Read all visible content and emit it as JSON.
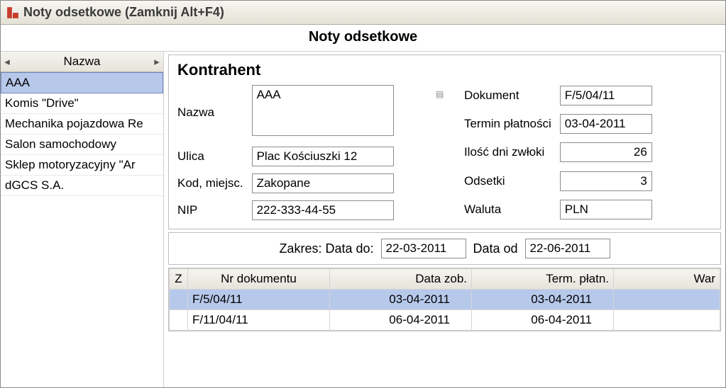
{
  "window": {
    "title": "Noty odsetkowe (Zamknij Alt+F4)"
  },
  "header": "Noty odsetkowe",
  "sidebar": {
    "column": "Nazwa",
    "items": [
      {
        "name": "AAA",
        "selected": true
      },
      {
        "name": "Komis \"Drive\""
      },
      {
        "name": "Mechanika pojazdowa Re"
      },
      {
        "name": "Salon samochodowy"
      },
      {
        "name": "Sklep motoryzacyjny \"Ar"
      },
      {
        "name": "dGCS S.A."
      }
    ]
  },
  "panel": {
    "title": "Kontrahent",
    "labels": {
      "nazwa": "Nazwa",
      "ulica": "Ulica",
      "kod": "Kod, miejsc.",
      "nip": "NIP",
      "dokument": "Dokument",
      "termin": "Termin płatności",
      "zwloka": "Ilość dni zwłoki",
      "odsetki": "Odsetki",
      "waluta": "Waluta"
    },
    "values": {
      "nazwa": "AAA",
      "ulica": "Plac Kościuszki 12",
      "kod": "Zakopane",
      "nip": "222-333-44-55",
      "dokument": "F/5/04/11",
      "termin": "03-04-2011",
      "zwloka": "26",
      "odsetki": "3",
      "waluta": "PLN"
    }
  },
  "range": {
    "prefix": "Zakres: Data do:",
    "date_to": "22-03-2011",
    "mid": "Data od",
    "date_from": "22-06-2011"
  },
  "table": {
    "columns": {
      "z": "Z",
      "doc": "Nr dokumentu",
      "date": "Data zob.",
      "term": "Term. płatn.",
      "war": "War"
    },
    "rows": [
      {
        "z": "",
        "doc": "F/5/04/11",
        "date": "03-04-2011",
        "term": "03-04-2011",
        "selected": true
      },
      {
        "z": "",
        "doc": "F/11/04/11",
        "date": "06-04-2011",
        "term": "06-04-2011"
      }
    ]
  }
}
